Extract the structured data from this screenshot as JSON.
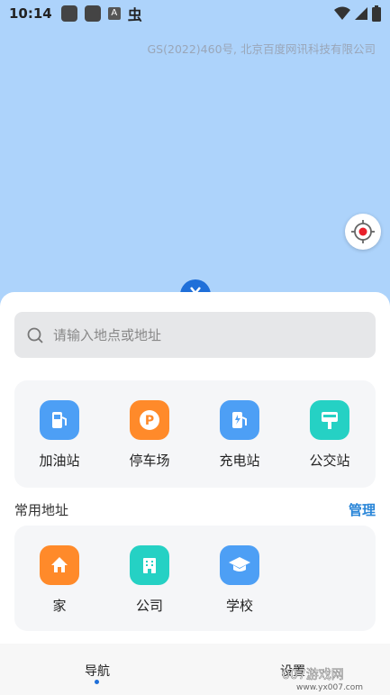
{
  "status_bar": {
    "time": "10:14",
    "notification_icons": [
      "app-icon",
      "app-icon",
      "a-icon",
      "bug-icon"
    ],
    "a_glyph": "A",
    "bug_glyph": "虫"
  },
  "map": {
    "copyright": "GS(2022)460号, 北京百度网讯科技有限公司"
  },
  "search": {
    "placeholder": "请输入地点或地址"
  },
  "quick_access": [
    {
      "label": "加油站",
      "icon": "gas-station-icon",
      "color": "#4d9ff5"
    },
    {
      "label": "停车场",
      "icon": "parking-icon",
      "color": "#ff8a2a"
    },
    {
      "label": "充电站",
      "icon": "charging-station-icon",
      "color": "#4d9ff5"
    },
    {
      "label": "公交站",
      "icon": "bus-stop-icon",
      "color": "#25d1c4"
    }
  ],
  "common_addresses": {
    "title": "常用地址",
    "manage_label": "管理",
    "items": [
      {
        "label": "家",
        "icon": "home-icon",
        "color": "#ff8a2a"
      },
      {
        "label": "公司",
        "icon": "company-icon",
        "color": "#25d1c4"
      },
      {
        "label": "学校",
        "icon": "school-icon",
        "color": "#4d9ff5"
      }
    ]
  },
  "tabbar": {
    "nav_label": "导航",
    "settings_label": "设置"
  },
  "watermark": "007游戏网 www.yx007.com"
}
